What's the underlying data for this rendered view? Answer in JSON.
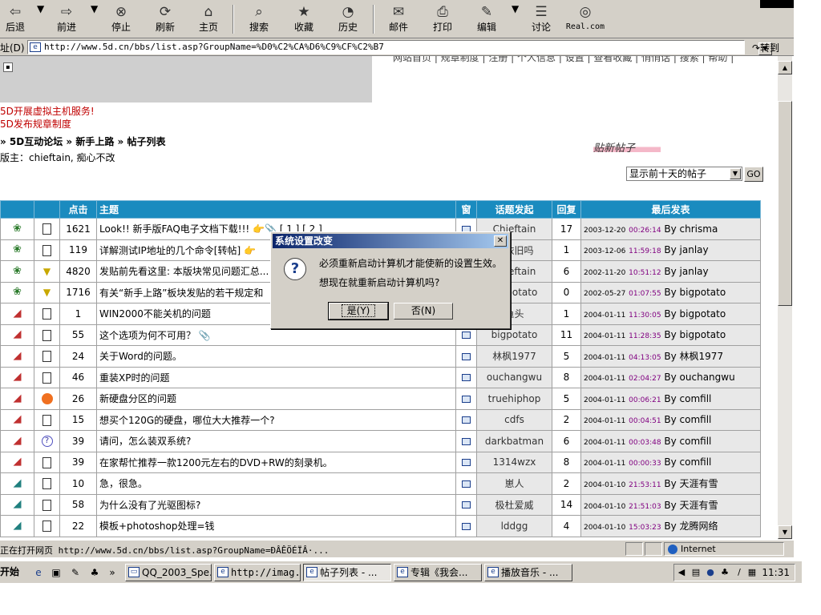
{
  "toolbar": {
    "back": "后退",
    "forward": "前进",
    "stop": "停止",
    "refresh": "刷新",
    "home": "主页",
    "search": "搜索",
    "favorites": "收藏",
    "history": "历史",
    "mail": "邮件",
    "print": "打印",
    "edit": "编辑",
    "discuss": "讨论",
    "real": "Real.com"
  },
  "address": {
    "label": "址(D)",
    "url": "http://www.5d.cn/bbs/list.asp?GroupName=%D0%C2%CA%D6%C9%CF%C2%B7",
    "go": "转到"
  },
  "page": {
    "topnav": "网站首页 | 规章制度 | 注册 | 个人信息 | 设置 | 查看收藏 | 悄悄话 | 搜索 | 帮助 |",
    "notice1": "5D开展虚拟主机服务!",
    "notice2": "5D发布规章制度",
    "breadcrumb": "» 5D互动论坛 » 新手上路 » 帖子列表",
    "moderators": "版主：chieftain, 痴心不改",
    "new_post": "贴新帖子",
    "filter_value": "显示前十天的帖子",
    "filter_go": "GO"
  },
  "table": {
    "headers": {
      "views": "点击",
      "subject": "主题",
      "window": "窗",
      "author": "话题发起",
      "replies": "回复",
      "last": "最后发表"
    },
    "rows": [
      {
        "type": "folder",
        "mood": "doc",
        "views": "1621",
        "subject": "Look!! 新手版FAQ电子文档下载!!! 👉📎 [ 1 ] [ 2 ]",
        "author": "Chieftain",
        "replies": "17",
        "date": "2003-12-20",
        "time": "00:26:14",
        "by": "By chrisma"
      },
      {
        "type": "folder",
        "mood": "doc",
        "views": "119",
        "subject": "详解测试IP地址的几个命令[转帖] 👉",
        "author": "依依旧吗",
        "replies": "1",
        "date": "2003-12-06",
        "time": "11:59:18",
        "by": "By janlay"
      },
      {
        "type": "folder",
        "mood": "warn",
        "views": "4820",
        "subject": "发贴前先看这里: 本版块常见问题汇总...",
        "author": "Chieftain",
        "replies": "6",
        "date": "2002-11-20",
        "time": "10:51:12",
        "by": "By janlay"
      },
      {
        "type": "folder",
        "mood": "warn",
        "views": "1716",
        "subject": "有关“新手上路”板块发贴的若干规定和",
        "author": "bigpotato",
        "replies": "0",
        "date": "2002-05-27",
        "time": "01:07:55",
        "by": "By bigpotato"
      },
      {
        "type": "shoe",
        "mood": "doc",
        "views": "1",
        "subject": "WIN2000不能关机的问题",
        "author": "鱼头",
        "replies": "1",
        "date": "2004-01-11",
        "time": "11:30:05",
        "by": "By bigpotato"
      },
      {
        "type": "shoe",
        "mood": "doc",
        "views": "55",
        "subject": "这个选项为何不可用？ 📎",
        "author": "bigpotato",
        "replies": "11",
        "date": "2004-01-11",
        "time": "11:28:35",
        "by": "By bigpotato"
      },
      {
        "type": "shoe",
        "mood": "doc",
        "views": "24",
        "subject": "关于Word的问题。",
        "author": "林枫1977",
        "replies": "5",
        "date": "2004-01-11",
        "time": "04:13:05",
        "by": "By 林枫1977"
      },
      {
        "type": "shoe",
        "mood": "doc",
        "views": "46",
        "subject": "重装XP时的问题",
        "author": "ouchangwu",
        "replies": "8",
        "date": "2004-01-11",
        "time": "02:04:27",
        "by": "By ouchangwu"
      },
      {
        "type": "shoe",
        "mood": "smile",
        "views": "26",
        "subject": "新硬盘分区的问题",
        "author": "truehiphop",
        "replies": "5",
        "date": "2004-01-11",
        "time": "00:06:21",
        "by": "By comfill"
      },
      {
        "type": "shoe",
        "mood": "doc",
        "views": "15",
        "subject": "想买个120G的硬盘，哪位大大推荐一个?",
        "author": "cdfs",
        "replies": "2",
        "date": "2004-01-11",
        "time": "00:04:51",
        "by": "By comfill"
      },
      {
        "type": "shoe",
        "mood": "quest",
        "views": "39",
        "subject": "请问，怎么装双系统?",
        "author": "darkbatman",
        "replies": "6",
        "date": "2004-01-11",
        "time": "00:03:48",
        "by": "By comfill"
      },
      {
        "type": "shoe",
        "mood": "doc",
        "views": "39",
        "subject": "在家帮忙推荐一款1200元左右的DVD+RW的刻录机。",
        "author": "1314wzx",
        "replies": "8",
        "date": "2004-01-11",
        "time": "00:00:33",
        "by": "By comfill"
      },
      {
        "type": "shoe-t",
        "mood": "doc",
        "views": "10",
        "subject": "急，很急。",
        "author": "崽人",
        "replies": "2",
        "date": "2004-01-10",
        "time": "21:53:11",
        "by": "By 天涯有雪"
      },
      {
        "type": "shoe-t",
        "mood": "doc",
        "views": "58",
        "subject": "为什么没有了光驱图标?",
        "author": "极杜爱威",
        "replies": "14",
        "date": "2004-01-10",
        "time": "21:51:03",
        "by": "By 天涯有雪"
      },
      {
        "type": "shoe-t",
        "mood": "doc",
        "views": "22",
        "subject": "模板+photoshop处理=钱",
        "author": "lddgg",
        "replies": "4",
        "date": "2004-01-10",
        "time": "15:03:23",
        "by": "By 龙腾网络"
      }
    ]
  },
  "dialog": {
    "title": "系统设置改变",
    "message1": "必须重新启动计算机才能使新的设置生效。",
    "message2": "想现在就重新启动计算机吗?",
    "yes": "是(Y)",
    "no": "否(N)"
  },
  "status": {
    "text": "正在打开网页 http://www.5d.cn/bbs/list.asp?GroupName=ÐÂÊÖÉÏÂ·...",
    "zone": "Internet"
  },
  "taskbar": {
    "start": "开始",
    "tasks": [
      "QQ_2003_Spe...",
      "http://imag...",
      "帖子列表 - ...",
      "专辑《我会...",
      "播放音乐 - ..."
    ],
    "clock": "11:31"
  }
}
